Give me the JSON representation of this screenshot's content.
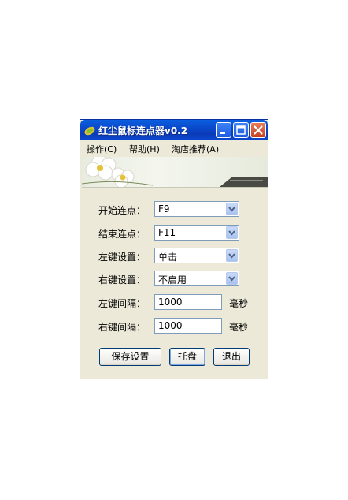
{
  "window": {
    "title": "红尘鼠标连点器v0.2"
  },
  "menu": {
    "items": [
      "操作(C)",
      "帮助(H)",
      "淘店推荐(A)"
    ]
  },
  "settings": {
    "start_label": "开始连点：",
    "start_value": "F9",
    "end_label": "结束连点：",
    "end_value": "F11",
    "left_label": "左键设置：",
    "left_value": "单击",
    "right_label": "右键设置：",
    "right_value": "不启用",
    "left_interval_label": "左键间隔：",
    "left_interval_value": "1000",
    "right_interval_label": "右键间隔：",
    "right_interval_value": "1000",
    "unit": "毫秒"
  },
  "buttons": {
    "save": "保存设置",
    "tray": "托盘",
    "exit": "退出"
  },
  "colors": {
    "titlebar": "#0a46c8",
    "window_bg": "#ece9d8",
    "close_button": "#c4401f"
  }
}
